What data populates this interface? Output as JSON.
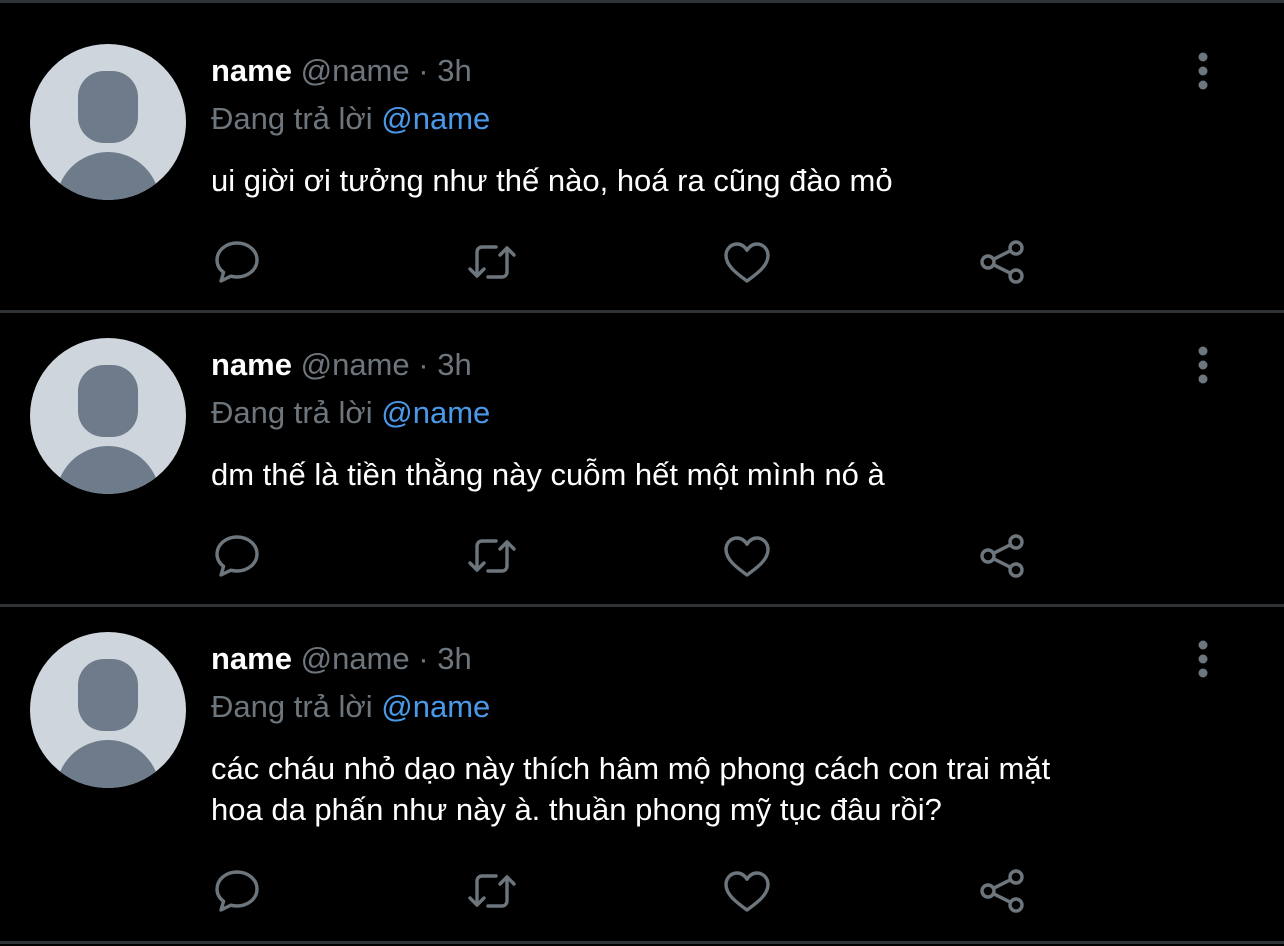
{
  "colors": {
    "background": "#000000",
    "separator": "#2f3336",
    "muted_text": "#6e767d",
    "mention": "#4a99e9",
    "primary_text": "#ffffff",
    "icon": "#6e767d",
    "avatar_bg": "#ced5dc",
    "avatar_fg": "#6e7b8b"
  },
  "icons": {
    "reply": "speech-bubble-icon",
    "retweet": "retweet-icon",
    "like": "heart-icon",
    "share": "share-icon",
    "more": "vertical-ellipsis-icon",
    "avatar": "default-user-avatar"
  },
  "tweets": [
    {
      "name": "name",
      "handle": "@name",
      "dot": "·",
      "time": "3h",
      "reply_prefix": "Đang trả lời",
      "reply_to": "@name",
      "lines": [
        "ui giời ơi tưởng như thế nào, hoá ra cũng đào mỏ"
      ]
    },
    {
      "name": "name",
      "handle": "@name",
      "dot": "·",
      "time": "3h",
      "reply_prefix": "Đang trả lời",
      "reply_to": "@name",
      "lines": [
        "dm thế là tiền thằng này cuỗm hết một mình nó à"
      ]
    },
    {
      "name": "name",
      "handle": "@name",
      "dot": "·",
      "time": "3h",
      "reply_prefix": "Đang trả lời",
      "reply_to": "@name",
      "lines": [
        "các cháu nhỏ dạo này thích hâm mộ phong cách con trai mặt",
        "hoa da phấn như này à. thuần phong mỹ tục đâu rồi?"
      ]
    }
  ]
}
